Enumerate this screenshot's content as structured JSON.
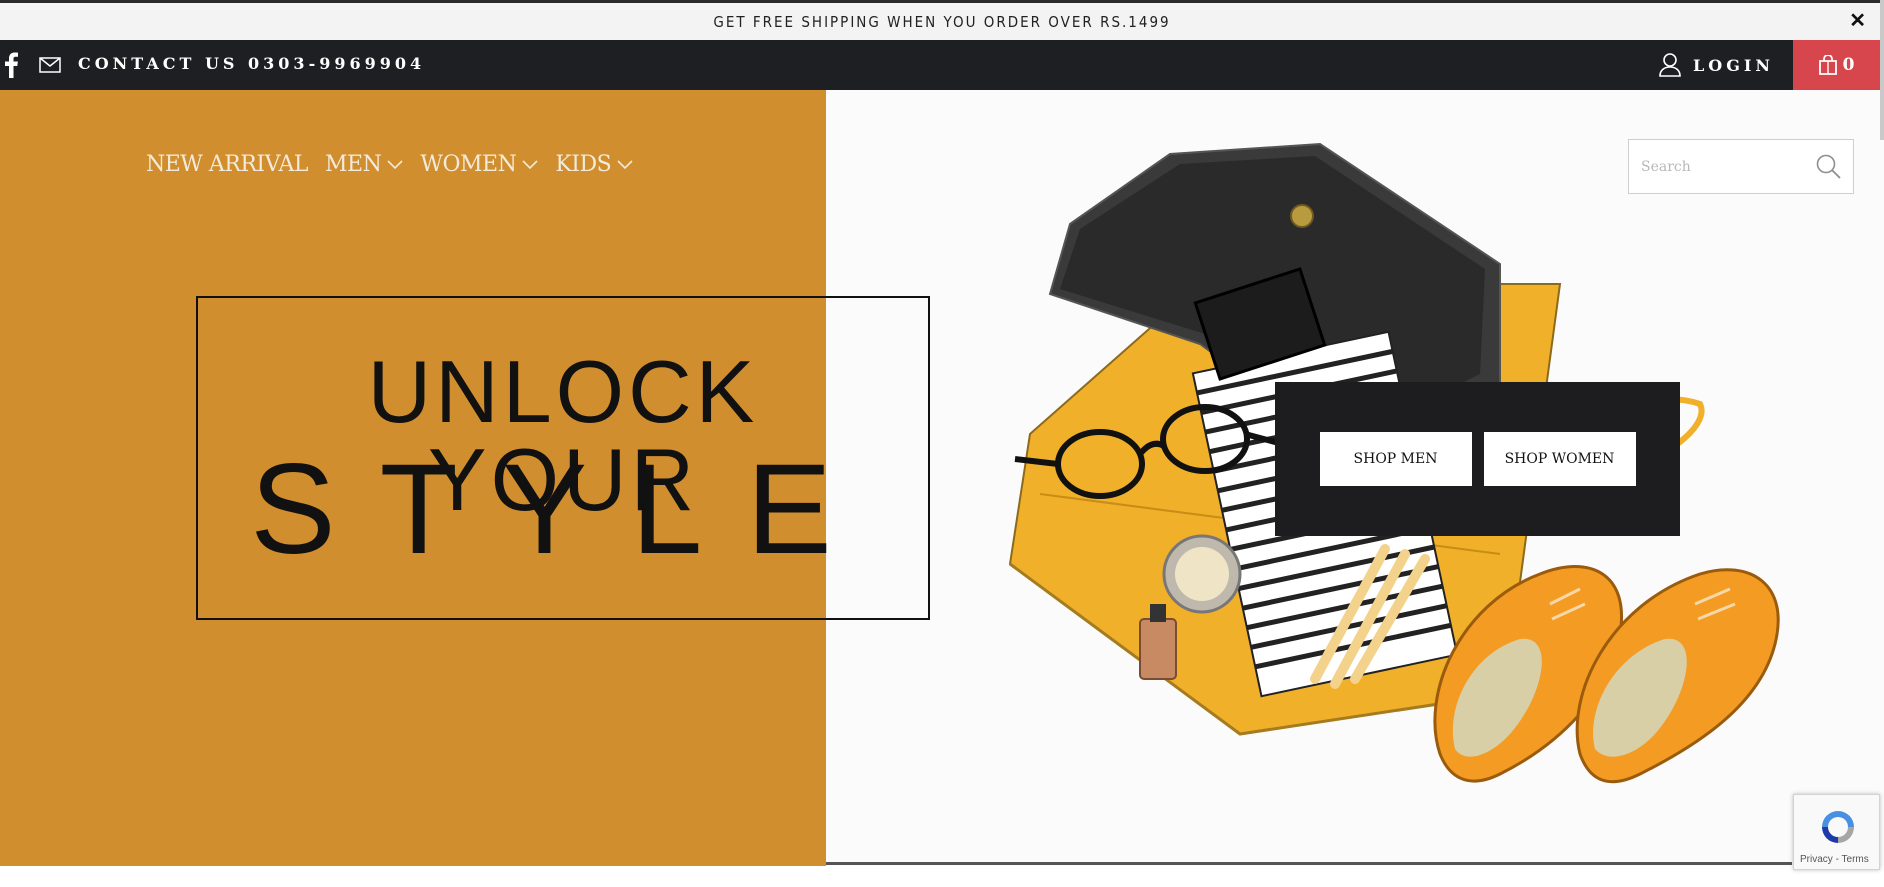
{
  "announcement": {
    "text": "GET FREE SHIPPING WHEN YOU ORDER OVER RS.1499",
    "close_icon": "close-icon"
  },
  "topbar": {
    "contact": "CONTACT US 0303-9969904",
    "login_label": "LOGIN",
    "cart_count": "0",
    "cart_color": "#d7464d",
    "bar_color": "#1d1f22"
  },
  "nav": {
    "items": [
      {
        "label": "NEW ARRIVAL",
        "dropdown": false
      },
      {
        "label": "MEN",
        "dropdown": true
      },
      {
        "label": "WOMEN",
        "dropdown": true
      },
      {
        "label": "KIDS",
        "dropdown": true
      }
    ]
  },
  "search": {
    "placeholder": "Search"
  },
  "hero": {
    "headline_line1": "UNLOCK YOUR",
    "headline_line2": "STYLE",
    "accent_color": "#d08e2e",
    "shop_men_label": "SHOP MEN",
    "shop_women_label": "SHOP WOMEN"
  },
  "recaptcha": {
    "privacy": "Privacy",
    "separator": " - ",
    "terms": "Terms"
  }
}
